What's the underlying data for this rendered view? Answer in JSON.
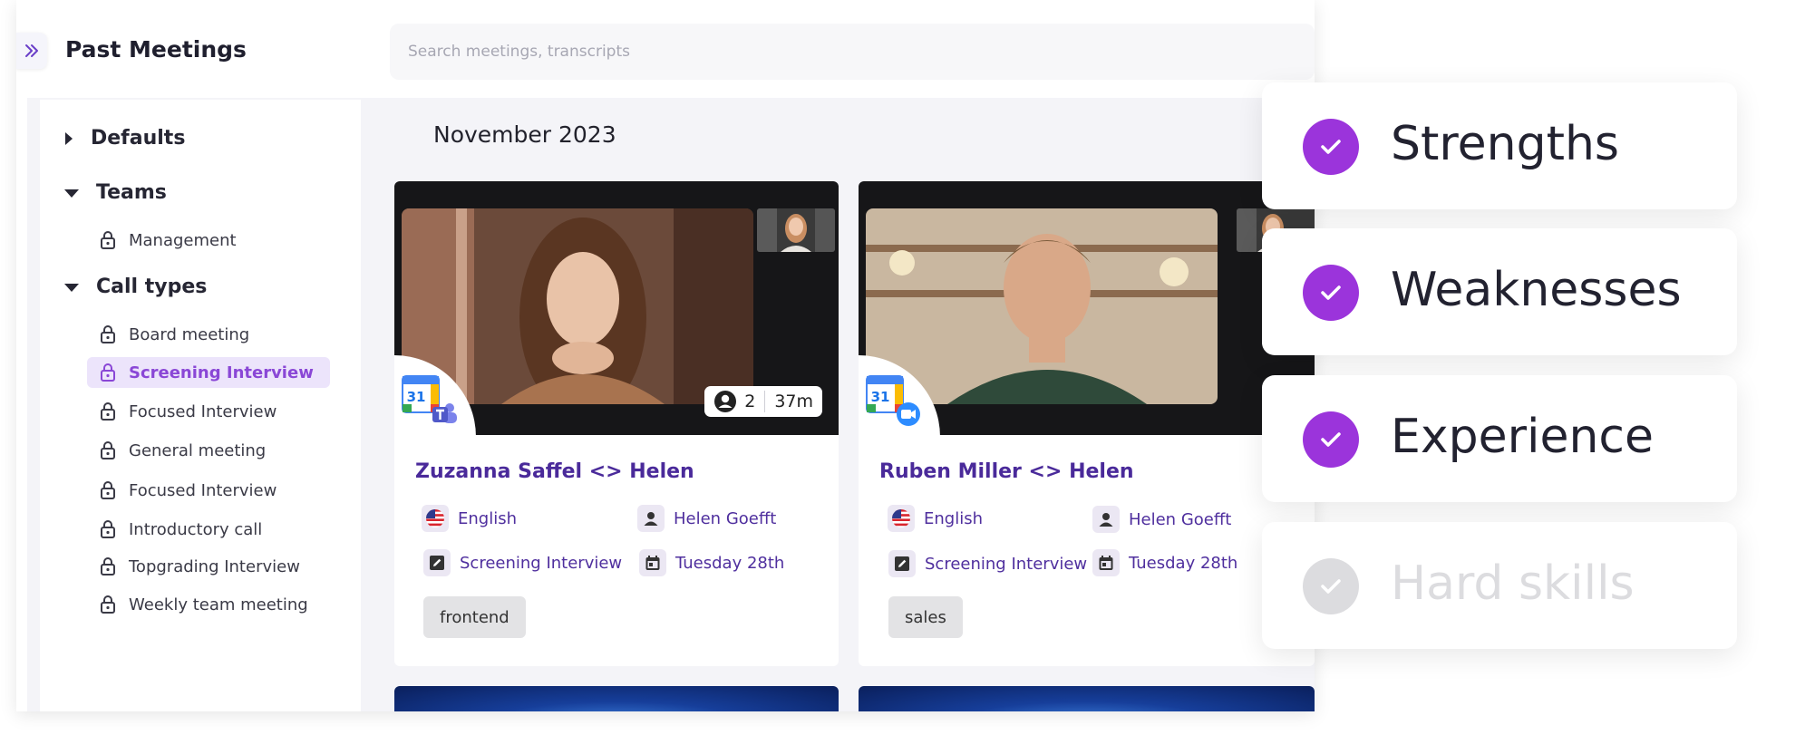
{
  "app": {
    "title": "Past Meetings",
    "search_placeholder": "Search meetings, transcripts",
    "month": "November 2023"
  },
  "sidebar": {
    "groups": [
      {
        "label": "Defaults",
        "expanded": false
      },
      {
        "label": "Teams",
        "expanded": true,
        "items": [
          "Management"
        ]
      },
      {
        "label": "Call types",
        "expanded": true,
        "items": [
          "Board meeting",
          "Screening Interview",
          "Focused Interview",
          "General meeting",
          "Focused Interview",
          "Introductory call",
          "Topgrading Interview",
          "Weekly team meeting"
        ],
        "active_item": "Screening Interview"
      }
    ]
  },
  "cards": [
    {
      "title": "Zuzanna Saffel <> Helen",
      "language": "English",
      "host": "Helen Goefft",
      "call_type": "Screening Interview",
      "date": "Tuesday 28th",
      "tag": "frontend",
      "participants": "2",
      "duration": "37m",
      "calendar_day": "31",
      "integration_icon": "teams-icon"
    },
    {
      "title": "Ruben Miller <> Helen",
      "language": "English",
      "host": "Helen Goefft",
      "call_type": "Screening Interview",
      "date": "Tuesday 28th",
      "tag": "sales",
      "calendar_day": "31",
      "integration_icon": "zoom-icon"
    }
  ],
  "features": [
    {
      "label": "Strengths",
      "checked": true
    },
    {
      "label": "Weaknesses",
      "checked": true
    },
    {
      "label": "Experience",
      "checked": true
    },
    {
      "label": "Hard skills",
      "checked": false
    }
  ],
  "colors": {
    "accent": "#9b34db",
    "title_purple": "#4a2a9a",
    "active_bg": "#ece4fb"
  }
}
